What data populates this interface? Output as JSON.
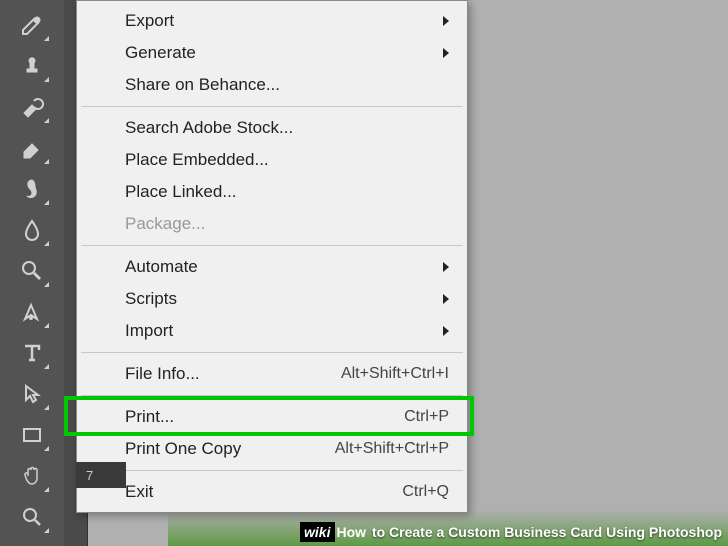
{
  "toolbar": {
    "tools": [
      "brush",
      "stamp",
      "history-brush",
      "eraser",
      "gradient",
      "blur",
      "dodge",
      "pen",
      "type",
      "path-select",
      "rectangle",
      "hand",
      "zoom"
    ]
  },
  "menu": {
    "items": [
      {
        "label": "Export",
        "submenu": true
      },
      {
        "label": "Generate",
        "submenu": true
      },
      {
        "label": "Share on Behance..."
      },
      {
        "sep": true
      },
      {
        "label": "Search Adobe Stock..."
      },
      {
        "label": "Place Embedded..."
      },
      {
        "label": "Place Linked..."
      },
      {
        "label": "Package...",
        "disabled": true
      },
      {
        "sep": true
      },
      {
        "label": "Automate",
        "submenu": true
      },
      {
        "label": "Scripts",
        "submenu": true
      },
      {
        "label": "Import",
        "submenu": true
      },
      {
        "sep": true
      },
      {
        "label": "File Info...",
        "shortcut": "Alt+Shift+Ctrl+I"
      },
      {
        "sep": true
      },
      {
        "label": "Print...",
        "shortcut": "Ctrl+P",
        "highlight": true
      },
      {
        "label": "Print One Copy",
        "shortcut": "Alt+Shift+Ctrl+P"
      },
      {
        "sep": true
      },
      {
        "label": "Exit",
        "shortcut": "Ctrl+Q"
      }
    ]
  },
  "ruler_tick": "7",
  "caption": {
    "brand": "wiki",
    "title": "How to Create a Custom Business Card Using Photoshop"
  }
}
